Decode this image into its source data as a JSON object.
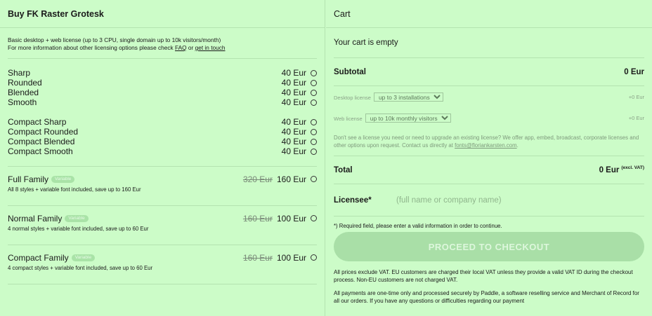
{
  "left": {
    "title": "Buy FK Raster Grotesk",
    "intro_line1": "Basic desktop + web license (up to 3 CPU, single domain up to 10k visitors/month)",
    "intro_line2_prefix": "For more information about other licensing options please check ",
    "faq_link": "FAQ",
    "intro_or": " or ",
    "contact_link": "get in touch",
    "group1": [
      {
        "name": "Sharp",
        "price": "40 Eur"
      },
      {
        "name": "Rounded",
        "price": "40 Eur"
      },
      {
        "name": "Blended",
        "price": "40 Eur"
      },
      {
        "name": "Smooth",
        "price": "40 Eur"
      }
    ],
    "group2": [
      {
        "name": "Compact Sharp",
        "price": "40 Eur"
      },
      {
        "name": "Compact Rounded",
        "price": "40 Eur"
      },
      {
        "name": "Compact Blended",
        "price": "40 Eur"
      },
      {
        "name": "Compact Smooth",
        "price": "40 Eur"
      }
    ],
    "families": [
      {
        "name": "Full Family",
        "badge": "Variable",
        "old_price": "320 Eur",
        "price": "160 Eur",
        "desc": "All 8 styles + variable font included, save up to 160 Eur"
      },
      {
        "name": "Normal Family",
        "badge": "Variable",
        "old_price": "160 Eur",
        "price": "100 Eur",
        "desc": "4 normal styles + variable font included, save up to 60 Eur"
      },
      {
        "name": "Compact Family",
        "badge": "Variable",
        "old_price": "160 Eur",
        "price": "100 Eur",
        "desc": "4 compact styles + variable font included, save up to 60 Eur"
      }
    ]
  },
  "cart": {
    "title": "Cart",
    "empty": "Your cart is empty",
    "subtotal_label": "Subtotal",
    "subtotal_value": "0 Eur",
    "desktop_label": "Desktop license",
    "desktop_value": "up to 3 installations",
    "desktop_price": "+0 Eur",
    "web_label": "Web license",
    "web_value": "up to 10k monthly visitors",
    "web_price": "+0 Eur",
    "note": "Don't see a license you need or need to upgrade an existing license? We offer app, embed, broadcast, corporate licenses and other options upon request. Contact us directly at ",
    "note_email": "fonts@floriankarsten.com",
    "note_end": ".",
    "total_label": "Total",
    "total_value": "0 Eur",
    "total_sup": "(excl. VAT)",
    "licensee_label": "Licensee*",
    "licensee_placeholder": "(full name or company name)",
    "required": "*) Required field, please enter a valid information in order to continue.",
    "checkout": "PROCEED TO CHECKOUT",
    "foot1": "All prices exclude VAT. EU customers are charged their local VAT unless they provide a valid VAT ID during the checkout process. Non-EU customers are not charged VAT.",
    "foot2": "All payments are one-time only and processed securely by Paddle, a software reselling service and Merchant of Record for all our orders. If you have any questions or difficulties regarding our payment"
  }
}
